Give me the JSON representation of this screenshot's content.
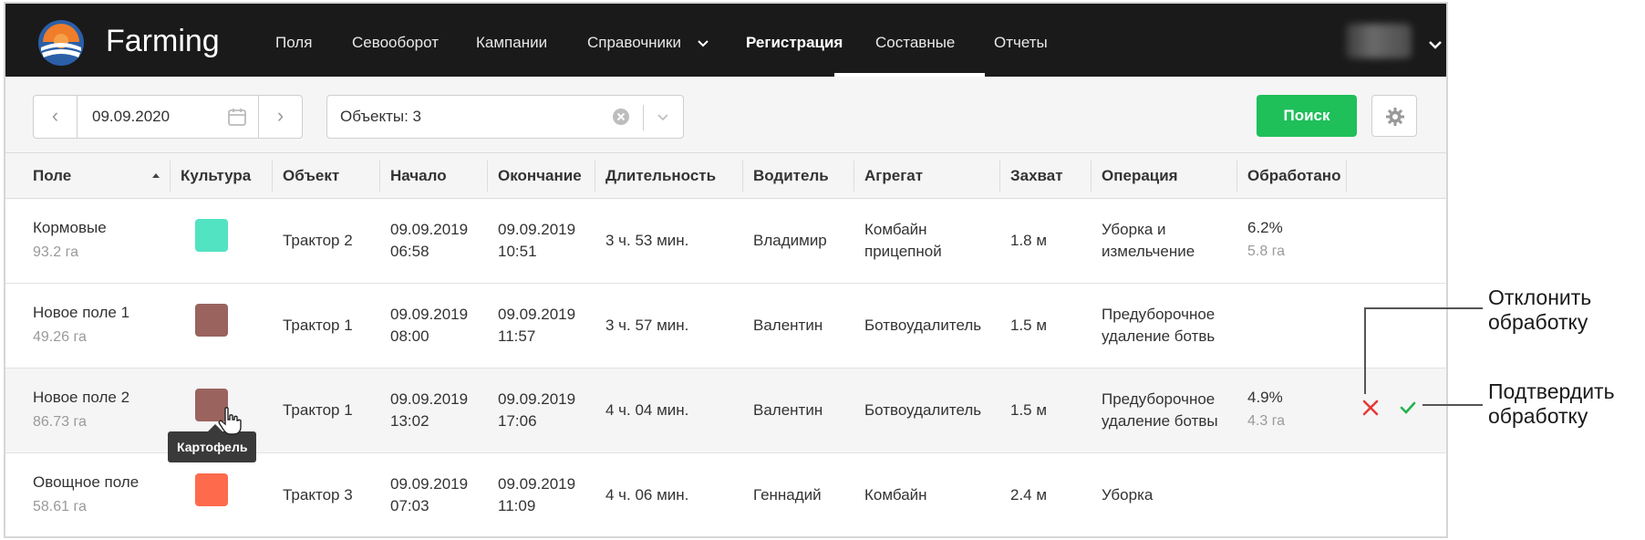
{
  "app": {
    "title": "Farming"
  },
  "nav": {
    "items": [
      {
        "label": "Поля"
      },
      {
        "label": "Севооборот"
      },
      {
        "label": "Кампании"
      },
      {
        "label": "Справочники"
      },
      {
        "label": "Регистрация",
        "active": true
      },
      {
        "label": "Составные"
      },
      {
        "label": "Отчеты"
      }
    ]
  },
  "toolbar": {
    "date": "09.09.2020",
    "objects": "Объекты: 3",
    "search_label": "Поиск"
  },
  "table": {
    "columns": [
      "Поле",
      "Культура",
      "Объект",
      "Начало",
      "Окончание",
      "Длительность",
      "Водитель",
      "Агрегат",
      "Захват",
      "Операция",
      "Обработано"
    ],
    "rows": [
      {
        "field": "Кормовые",
        "area": "93.2 га",
        "crop_color": "#52e3c2",
        "object": "Трактор 2",
        "start_date": "09.09.2019",
        "start_time": "06:58",
        "end_date": "09.09.2019",
        "end_time": "10:51",
        "duration": "3 ч. 53 мин.",
        "driver": "Владимир",
        "unit_1": "Комбайн",
        "unit_2": "прицепной",
        "width": "1.8 м",
        "op_1": "Уборка и",
        "op_2": "измельчение",
        "processed_pct": "6.2%",
        "processed_area": "5.8 га"
      },
      {
        "field": "Новое поле 1",
        "area": "49.26 га",
        "crop_color": "#9a635e",
        "object": "Трактор 1",
        "start_date": "09.09.2019",
        "start_time": "08:00",
        "end_date": "09.09.2019",
        "end_time": "11:57",
        "duration": "3 ч. 57 мин.",
        "driver": "Валентин",
        "unit_1": "Ботвоудалитель",
        "unit_2": "",
        "width": "1.5 м",
        "op_1": "Предуборочное",
        "op_2": "удаление ботвь",
        "processed_pct": "",
        "processed_area": ""
      },
      {
        "field": "Новое поле 2",
        "area": "86.73 га",
        "crop_color": "#9a635e",
        "object": "Трактор 1",
        "start_date": "09.09.2019",
        "start_time": "13:02",
        "end_date": "09.09.2019",
        "end_time": "17:06",
        "duration": "4 ч. 04 мин.",
        "driver": "Валентин",
        "unit_1": "Ботвоудалитель",
        "unit_2": "",
        "width": "1.5 м",
        "op_1": "Предуборочное",
        "op_2": "удаление ботвы",
        "processed_pct": "4.9%",
        "processed_area": "4.3 га"
      },
      {
        "field": "Овощное поле",
        "area": "58.61 га",
        "crop_color": "#fd6a4c",
        "object": "Трактор 3",
        "start_date": "09.09.2019",
        "start_time": "07:03",
        "end_date": "09.09.2019",
        "end_time": "11:09",
        "duration": "4 ч. 06 мин.",
        "driver": "Геннадий",
        "unit_1": "Комбайн",
        "unit_2": "",
        "width": "2.4 м",
        "op_1": "Уборка",
        "op_2": "",
        "processed_pct": "",
        "processed_area": ""
      }
    ]
  },
  "tooltip": {
    "text": "Картофель"
  },
  "callouts": {
    "reject_1": "Отклонить",
    "reject_2": "обработку",
    "confirm_1": "Подтвердить",
    "confirm_2": "обработку"
  },
  "colors": {
    "topbar": "#1a1a1a",
    "search_button": "#1fbf5a",
    "reject": "#e53935",
    "confirm": "#22b24c"
  },
  "icons": [
    "logo-icon",
    "chevron-down-icon",
    "calendar-icon",
    "clear-icon",
    "gear-icon",
    "sort-icon",
    "close-icon",
    "check-icon",
    "cursor-icon"
  ]
}
